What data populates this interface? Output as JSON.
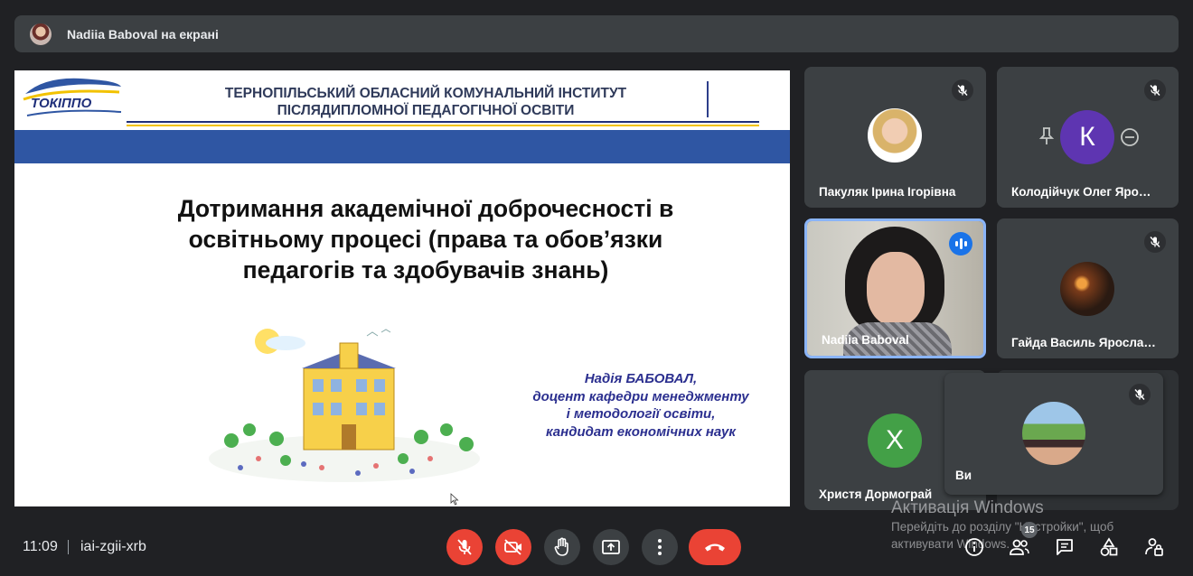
{
  "presenter_bar": {
    "label": "Nadiia Baboval на екрані"
  },
  "slide": {
    "logo_text": "ТОКІППО",
    "org_line1": "ТЕРНОПІЛЬСЬКИЙ ОБЛАСНИЙ КОМУНАЛЬНИЙ ІНСТИТУТ",
    "org_line2": "ПІСЛЯДИПЛОМНОЇ ПЕДАГОГІЧНОЇ ОСВІТИ",
    "title_line1": "Дотримання академічної доброчесності в",
    "title_line2": "освітньому процесі (права та обов’язки",
    "title_line3": "педагогів та здобувачів знань)",
    "author_line1": "Надія БАБОВАЛ,",
    "author_line2": "доцент кафедри менеджменту",
    "author_line3": "і методології освіти,",
    "author_line4": "кандидат економічних наук"
  },
  "participants": [
    {
      "name": "Пакуляк Ірина Ігорівна",
      "muted": true
    },
    {
      "name": "Колодійчук Олег Яро…",
      "muted": true,
      "avatar_letter": "К"
    },
    {
      "name": "Nadiia Baboval",
      "muted": false,
      "speaking": true
    },
    {
      "name": "Гайда Василь Яросла…",
      "muted": true
    },
    {
      "name": "Христя Дормограй",
      "muted": false,
      "avatar_letter": "X",
      "avatar_color": "#43a047"
    },
    {
      "name": "Ви",
      "muted": true,
      "self": true
    }
  ],
  "bottom_bar": {
    "time": "11:09",
    "meeting_code": "iai-zgii-xrb",
    "participant_count": "15"
  },
  "colors": {
    "end_call": "#ea4335",
    "active_speaker": "#8ab4f8",
    "slide_band": "#2f56a3"
  },
  "watermark": {
    "title": "Активація Windows",
    "line1": "Перейдіть до розділу \"Настройки\", щоб",
    "line2": "активувати Windows."
  }
}
